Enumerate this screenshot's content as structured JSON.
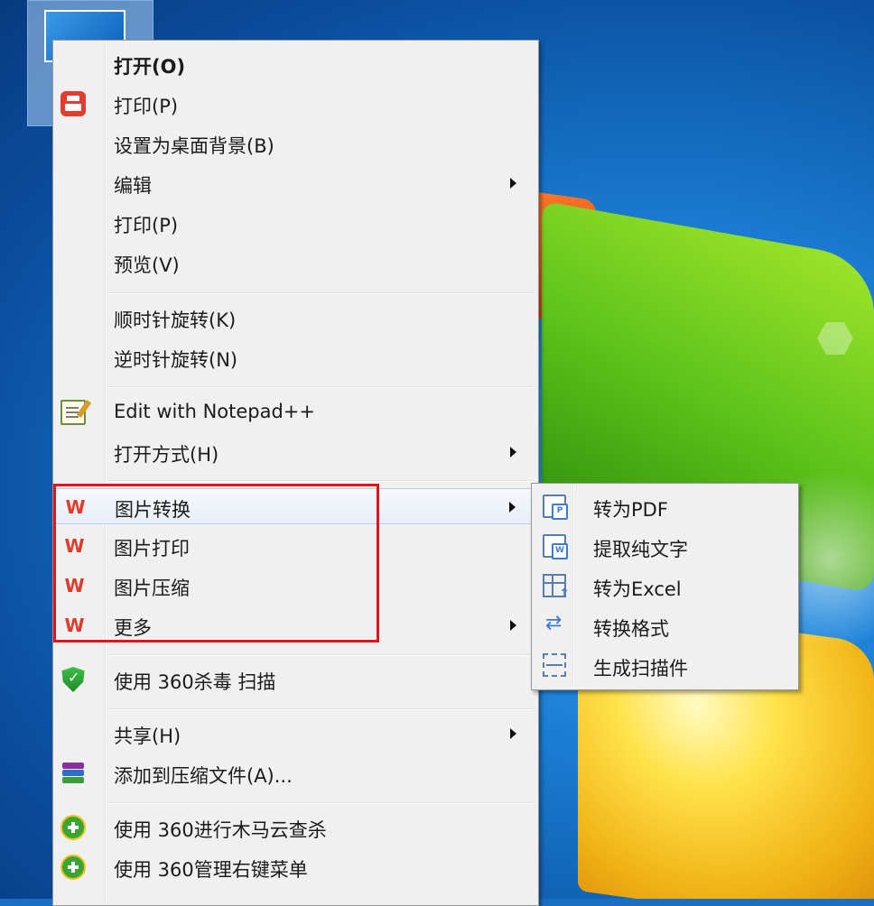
{
  "context_menu": {
    "items": [
      {
        "label": "打开(O)",
        "bold": true
      },
      {
        "label": "打印(P)",
        "icon": "printer-icon"
      },
      {
        "label": "设置为桌面背景(B)"
      },
      {
        "label": "编辑",
        "submenu": true
      },
      {
        "label": "打印(P)"
      },
      {
        "label": "预览(V)"
      },
      {
        "label": "顺时针旋转(K)"
      },
      {
        "label": "逆时针旋转(N)"
      },
      {
        "label": "Edit with Notepad++",
        "icon": "notepad-plus-plus-icon"
      },
      {
        "label": "打开方式(H)",
        "submenu": true
      },
      {
        "label": "图片转换",
        "icon": "wps-icon",
        "submenu": true,
        "highlighted": true
      },
      {
        "label": "图片打印",
        "icon": "wps-icon"
      },
      {
        "label": "图片压缩",
        "icon": "wps-icon"
      },
      {
        "label": "更多",
        "icon": "wps-icon",
        "submenu": true
      },
      {
        "label": "使用 360杀毒 扫描",
        "icon": "shield-icon"
      },
      {
        "label": "共享(H)",
        "submenu": true
      },
      {
        "label": "添加到压缩文件(A)...",
        "icon": "winrar-icon"
      },
      {
        "label": "使用 360进行木马云查杀",
        "icon": "360-plus-icon"
      },
      {
        "label": "使用 360管理右键菜单",
        "icon": "360-plus-icon"
      }
    ]
  },
  "submenu": {
    "items": [
      {
        "label": "转为PDF",
        "icon": "convert-pdf-icon"
      },
      {
        "label": "提取纯文字",
        "icon": "extract-text-icon"
      },
      {
        "label": "转为Excel",
        "icon": "convert-excel-icon"
      },
      {
        "label": "转换格式",
        "icon": "convert-format-icon"
      },
      {
        "label": "生成扫描件",
        "icon": "scan-icon"
      }
    ]
  },
  "colors": {
    "highlight_box": "#e0141d",
    "wps_red": "#e33a2c",
    "menu_bg": "#f0f0f0"
  }
}
